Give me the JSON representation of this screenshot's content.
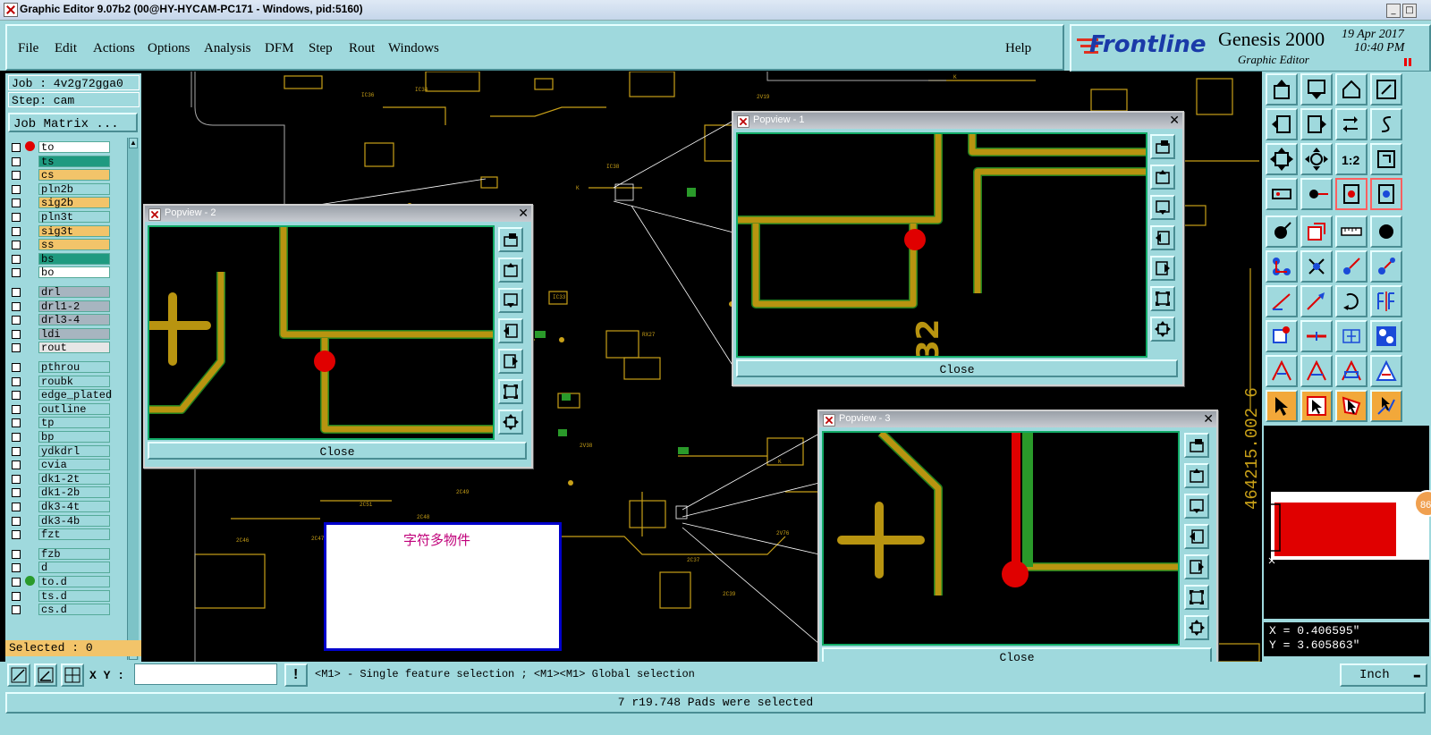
{
  "window": {
    "title": "Graphic Editor 9.07b2 (00@HY-HYCAM-PC171 - Windows, pid:5160)",
    "minimize_glyph": "_",
    "maximize_glyph": "□"
  },
  "menu": {
    "items": [
      "File",
      "Edit",
      "Actions",
      "Options",
      "Analysis",
      "DFM",
      "Step",
      "Rout",
      "Windows"
    ],
    "help": "Help"
  },
  "logo": {
    "brand": "Frontline",
    "product": "Genesis 2000",
    "subtitle": "Graphic Editor",
    "date": "19 Apr 2017",
    "time": "10:40 PM"
  },
  "left_panel": {
    "job": "Job : 4v2g72gga0",
    "step": "Step: cam",
    "job_matrix": "Job Matrix ...",
    "selected": "Selected : 0",
    "layers": [
      {
        "name": "to",
        "color": "#ffffff",
        "dot": "#e00000"
      },
      {
        "name": "ts",
        "color": "#1f9a80",
        "dot": ""
      },
      {
        "name": "cs",
        "color": "#f2c46a",
        "dot": ""
      },
      {
        "name": "pln2b",
        "color": "#9fd9dd",
        "dot": ""
      },
      {
        "name": "sig2b",
        "color": "#f2c46a",
        "dot": ""
      },
      {
        "name": "pln3t",
        "color": "#9fd9dd",
        "dot": ""
      },
      {
        "name": "sig3t",
        "color": "#f2c46a",
        "dot": ""
      },
      {
        "name": "ss",
        "color": "#f2c46a",
        "dot": ""
      },
      {
        "name": "bs",
        "color": "#1f9a80",
        "dot": ""
      },
      {
        "name": "bo",
        "color": "#ffffff",
        "dot": ""
      },
      {
        "name": "drl",
        "color": "#a7b5c0",
        "dot": ""
      },
      {
        "name": "drl1-2",
        "color": "#a7b5c0",
        "dot": ""
      },
      {
        "name": "drl3-4",
        "color": "#a7b5c0",
        "dot": ""
      },
      {
        "name": "ldi",
        "color": "#a7b5c0",
        "dot": ""
      },
      {
        "name": "rout",
        "color": "#e6e6e6",
        "dot": ""
      },
      {
        "name": "pthrou",
        "color": "#9fd9dd",
        "dot": ""
      },
      {
        "name": "roubk",
        "color": "#9fd9dd",
        "dot": ""
      },
      {
        "name": "edge_plated",
        "color": "#9fd9dd",
        "dot": ""
      },
      {
        "name": "outline",
        "color": "#9fd9dd",
        "dot": ""
      },
      {
        "name": "tp",
        "color": "#9fd9dd",
        "dot": ""
      },
      {
        "name": "bp",
        "color": "#9fd9dd",
        "dot": ""
      },
      {
        "name": "ydkdrl",
        "color": "#9fd9dd",
        "dot": ""
      },
      {
        "name": "cvia",
        "color": "#9fd9dd",
        "dot": ""
      },
      {
        "name": "dk1-2t",
        "color": "#9fd9dd",
        "dot": ""
      },
      {
        "name": "dk1-2b",
        "color": "#9fd9dd",
        "dot": ""
      },
      {
        "name": "dk3-4t",
        "color": "#9fd9dd",
        "dot": ""
      },
      {
        "name": "dk3-4b",
        "color": "#9fd9dd",
        "dot": ""
      },
      {
        "name": "fzt",
        "color": "#9fd9dd",
        "dot": ""
      },
      {
        "name": "fzb",
        "color": "#9fd9dd",
        "dot": ""
      },
      {
        "name": "d",
        "color": "#9fd9dd",
        "dot": ""
      },
      {
        "name": "to.d",
        "color": "#9fd9dd",
        "dot": "#2a9a2a"
      },
      {
        "name": "ts.d",
        "color": "#9fd9dd",
        "dot": ""
      },
      {
        "name": "cs.d",
        "color": "#9fd9dd",
        "dot": ""
      }
    ]
  },
  "popups": [
    {
      "title": "Popview - 1",
      "close": "Close"
    },
    {
      "title": "Popview - 2",
      "close": "Close"
    },
    {
      "title": "Popview - 3",
      "close": "Close"
    }
  ],
  "note_text": "字符多物件",
  "canvas_labels": {
    "coord_side": "464215.002 6"
  },
  "right_panel": {
    "coord_x": "X = 0.406595\"",
    "coord_y": "Y = 3.605863\"",
    "badge": "86"
  },
  "bottom": {
    "xy_label": "X Y :",
    "hint": "<M1> - Single feature selection ; <M1><M1> Global selection",
    "units": "Inch",
    "status": "7 r19.748 Pads were selected"
  }
}
